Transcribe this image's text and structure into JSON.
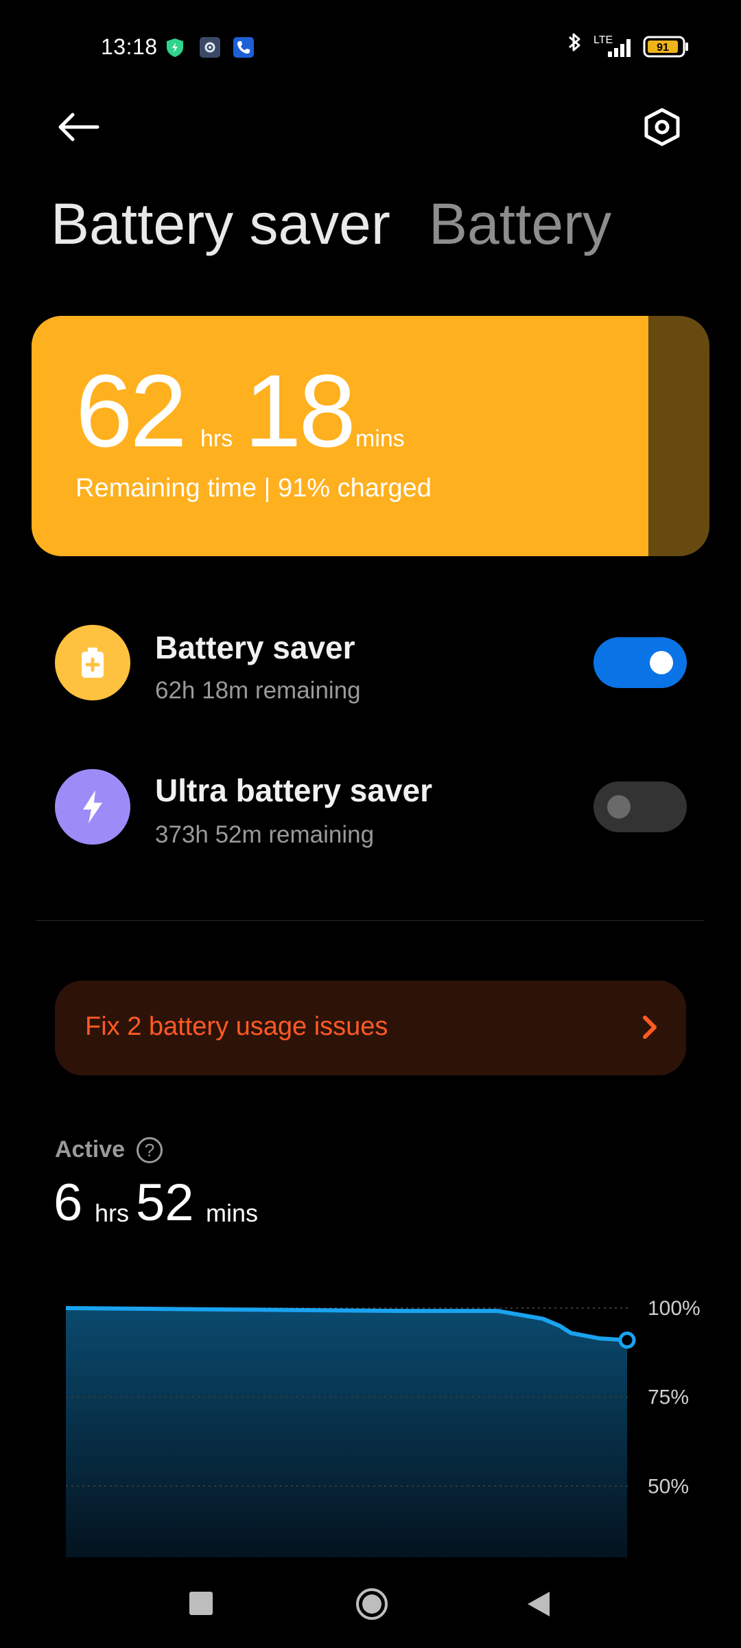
{
  "status_bar": {
    "time": "13:18",
    "network": "LTE",
    "battery_level": "91",
    "icons": [
      "shield-icon",
      "settings-icon",
      "phone-icon",
      "bluetooth-icon",
      "signal-icon",
      "battery-icon"
    ]
  },
  "header": {
    "tab_active": "Battery saver",
    "tab_inactive": "Battery"
  },
  "card": {
    "hours": "62",
    "hours_unit": "hrs",
    "minutes": "18",
    "minutes_unit": "mins",
    "subtitle": "Remaining time | 91% charged",
    "charge_fraction": 0.91,
    "color_fill": "#ffb01e",
    "color_empty": "#664a10"
  },
  "modes": [
    {
      "title": "Battery saver",
      "subtitle": "62h 18m remaining",
      "enabled": true,
      "icon": "battery-plus-icon",
      "icon_color": "#ffc240"
    },
    {
      "title": "Ultra battery saver",
      "subtitle": "373h 52m remaining",
      "enabled": false,
      "icon": "lightning-icon",
      "icon_color": "#9d8cf8"
    }
  ],
  "issues": {
    "label": "Fix 2 battery usage issues"
  },
  "active": {
    "label": "Active",
    "hours": "6",
    "hours_unit": "hrs",
    "minutes": "52",
    "minutes_unit": "mins"
  },
  "chart_data": {
    "type": "area",
    "y_ticks": [
      "100%",
      "75%",
      "50%"
    ],
    "ylim": [
      30,
      100
    ],
    "x": [
      0,
      0.3,
      0.6,
      0.77,
      0.85,
      0.88,
      0.9,
      0.95,
      1.0
    ],
    "values": [
      100,
      99.6,
      99.2,
      99.2,
      97,
      95,
      93,
      91.5,
      91
    ],
    "line_color": "#1aa3f0",
    "grid": true
  }
}
